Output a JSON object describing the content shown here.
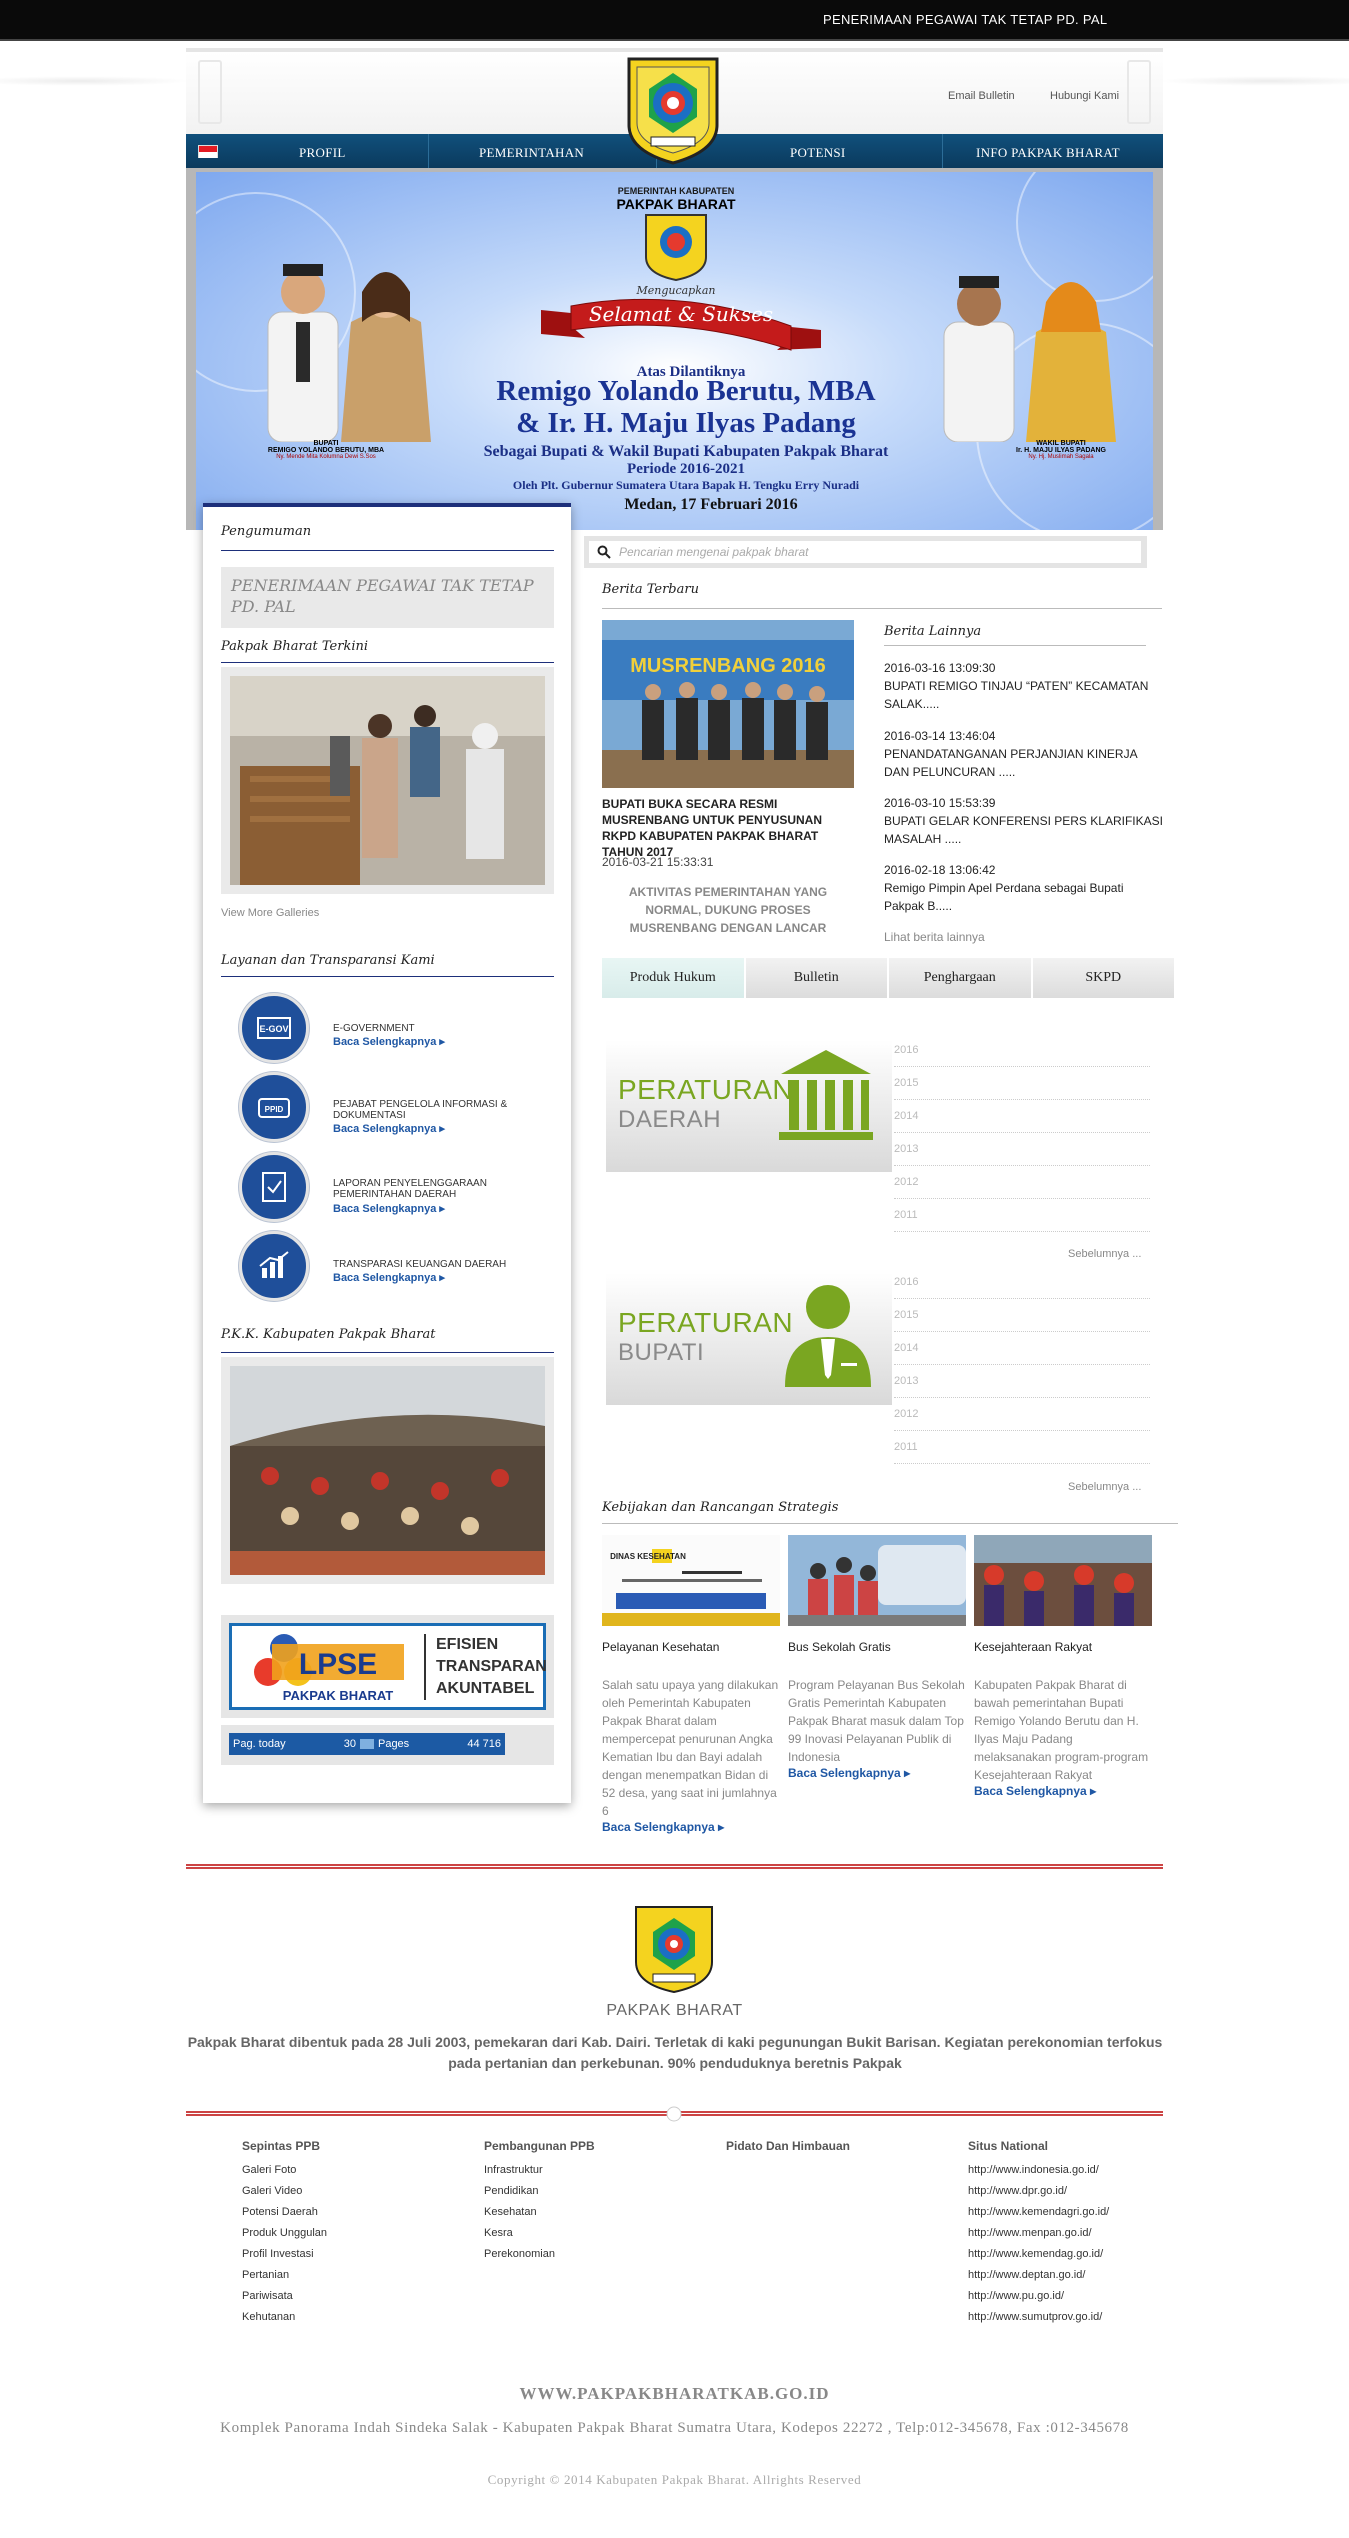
{
  "topbar": {
    "ticker": "PENERIMAAN PEGAWAI TAK TETAP PD. PAL"
  },
  "toplinks": {
    "email": "Email Bulletin",
    "contact": "Hubungi Kami"
  },
  "nav": {
    "items": [
      "PROFIL",
      "PEMERINTAHAN",
      "POTENSI",
      "INFO PAKPAK BHARAT"
    ]
  },
  "banner": {
    "line1": "PEMERINTAH KABUPATEN",
    "line2": "PAKPAK BHARAT",
    "line3": "Mengucapkan",
    "ribbon": "Selamat & Sukses",
    "line4": "Atas Dilantiknya",
    "name1": "Remigo Yolando Berutu, MBA",
    "name2": "& Ir. H. Maju Ilyas Padang",
    "line5": "Sebagai Bupati & Wakil Bupati Kabupaten Pakpak Bharat",
    "line6": "Periode 2016-2021",
    "line7": "Oleh Plt. Gubernur Sumatera Utara Bapak H. Tengku Erry Nuradi",
    "line8": "Medan, 17 Februari 2016",
    "cap_left": "BUPATI",
    "cap_left_name": "REMIGO YOLANDO BERUTU, MBA",
    "cap_left_spouse": "Ny. Mende Mita Kolumna Dewi S.Sos",
    "cap_right": "WAKIL BUPATI",
    "cap_right_name": "Ir. H. MAJU ILYAS PADANG",
    "cap_right_spouse": "Ny. Hj. Muslimah Sagala"
  },
  "sidebar": {
    "pengumuman_title": "Pengumuman",
    "pengumuman_text": "PENERIMAAN PEGAWAI TAK TETAP PD. PAL",
    "gallery_title": "Pakpak Bharat Terkini",
    "view_more": "View More Galleries",
    "layanan_title": "Layanan dan Transparansi Kami",
    "services": [
      {
        "icon": "egov-icon",
        "label": "E-GOVERNMENT",
        "more": "Baca Selengkapnya"
      },
      {
        "icon": "ppid-icon",
        "label": "PEJABAT PENGELOLA INFORMASI & DOKUMENTASI",
        "more": "Baca Selengkapnya"
      },
      {
        "icon": "report-icon",
        "label": "LAPORAN PENYELENGGARAAN PEMERINTAHAN DAERAH",
        "more": "Baca Selengkapnya"
      },
      {
        "icon": "finance-icon",
        "label": "TRANSPARASI KEUANGAN DAERAH",
        "more": "Baca Selengkapnya"
      }
    ],
    "pkk_title": "P.K.K. Kabupaten Pakpak Bharat",
    "lpse": {
      "logo": "LPSE",
      "sub": "PAKPAK BHARAT",
      "t1": "EFISIEN",
      "t2": "TRANSPARAN",
      "t3": "AKUNTABEL"
    },
    "counter": {
      "label1": "Pag. today",
      "val1": "30",
      "label2": "Pages",
      "val2": "44 716"
    }
  },
  "search": {
    "placeholder": "Pencarian mengenai pakpak bharat"
  },
  "berita": {
    "title": "Berita Terbaru",
    "banner_text": "MUSRENBANG 2016",
    "headline": "BUPATI BUKA SECARA RESMI MUSRENBANG UNTUK PENYUSUNAN RKPD KABUPATEN PAKPAK BHARAT TAHUN 2017",
    "date": "2016-03-21 15:33:31",
    "caption": "AKTIVITAS PEMERINTAHAN YANG NORMAL, DUKUNG PROSES MUSRENBANG DENGAN LANCAR"
  },
  "berita_lainnya": {
    "title": "Berita Lainnya",
    "items": [
      {
        "date": "2016-03-16 13:09:30",
        "text": "BUPATI REMIGO TINJAU “PATEN” KECAMATAN SALAK....."
      },
      {
        "date": "2016-03-14 13:46:04",
        "text": "PENANDATANGANAN PERJANJIAN KINERJA DAN PELUNCURAN ....."
      },
      {
        "date": "2016-03-10 15:53:39",
        "text": "BUPATI GELAR KONFERENSI PERS KLARIFIKASI MASALAH ....."
      },
      {
        "date": "2016-02-18 13:06:42",
        "text": "Remigo Pimpin Apel Perdana sebagai Bupati Pakpak B....."
      }
    ],
    "more": "Lihat berita lainnya"
  },
  "tabs": [
    "Produk Hukum",
    "Bulletin",
    "Penghargaan",
    "SKPD"
  ],
  "produk": {
    "perda": {
      "t1": "PERATURAN",
      "t2": "DAERAH"
    },
    "perbup": {
      "t1": "PERATURAN",
      "t2": "BUPATI"
    },
    "years": [
      "2016",
      "2015",
      "2014",
      "2013",
      "2012",
      "2011"
    ],
    "prev": "Sebelumnya ..."
  },
  "kebijakan": {
    "title": "Kebijakan dan Rancangan Strategis",
    "cards": [
      {
        "title": "Pelayanan Kesehatan",
        "text": "Salah satu upaya yang dilakukan oleh Pemerintah Kabupaten Pakpak Bharat dalam mempercepat penurunan Angka Kematian Ibu dan Bayi adalah dengan menempatkan Bidan di 52 desa, yang saat ini jumlahnya 6",
        "more": "Baca Selengkapnya",
        "img_text": "DINAS KESEHATAN"
      },
      {
        "title": "Bus Sekolah Gratis",
        "text": "Program Pelayanan Bus Sekolah Gratis Pemerintah Kabupaten Pakpak Bharat masuk dalam Top 99 Inovasi Pelayanan Publik di Indonesia",
        "more": "Baca Selengkapnya"
      },
      {
        "title": "Kesejahteraan Rakyat",
        "text": "Kabupaten Pakpak Bharat di bawah pemerintahan Bupati Remigo Yolando Berutu dan H. Ilyas Maju Padang melaksanakan program-program Kesejahteraan Rakyat",
        "more": "Baca Selengkapnya"
      }
    ]
  },
  "footer": {
    "name": "PAKPAK BHARAT",
    "desc": "Pakpak Bharat dibentuk pada 28 Juli 2003, pemekaran dari Kab. Dairi. Terletak di kaki pegunungan Bukit Barisan. Kegiatan perekonomian terfokus pada pertanian dan perkebunan. 90% penduduknya beretnis Pakpak",
    "cols": [
      {
        "head": "Sepintas PPB",
        "items": [
          "Galeri Foto",
          "Galeri Video",
          "Potensi Daerah",
          "Produk Unggulan",
          "Profil Investasi",
          "Pertanian",
          "Pariwisata",
          "Kehutanan"
        ]
      },
      {
        "head": "Pembangunan PPB",
        "items": [
          "Infrastruktur",
          "Pendidikan",
          "Kesehatan",
          "Kesra",
          "Perekonomian"
        ]
      },
      {
        "head": "Pidato Dan Himbauan",
        "items": []
      },
      {
        "head": "Situs National",
        "items": [
          "http://www.indonesia.go.id/",
          "http://www.dpr.go.id/",
          "http://www.kemendagri.go.id/",
          "http://www.menpan.go.id/",
          "http://www.kemendag.go.id/",
          "http://www.deptan.go.id/",
          "http://www.pu.go.id/",
          "http://www.sumutprov.go.id/"
        ]
      }
    ],
    "site": "WWW.PAKPAKBHARATKAB.GO.ID",
    "address": "Komplek Panorama Indah Sindeka Salak - Kabupaten Pakpak Bharat Sumatra Utara, Kodepos 22272 , Telp:012-345678, Fax :012-345678",
    "copyright": "Copyright © 2014 Kabupaten Pakpak Bharat. Allrights Reserved"
  },
  "colors": {
    "nav": "#0b3a5d",
    "accent": "#1d2f7a",
    "link": "#1f57a4",
    "green": "#7aa621",
    "divider": "#cc4444"
  }
}
